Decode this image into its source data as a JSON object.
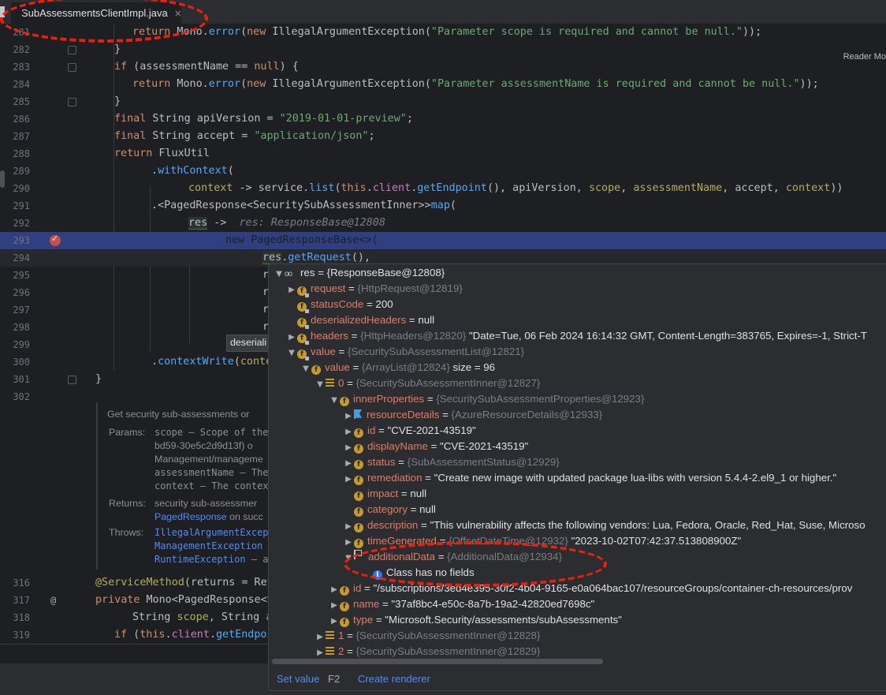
{
  "tab": {
    "label": "SubAssessmentsClientImpl.java",
    "close": "×"
  },
  "reader_mode": "Reader Mo",
  "lines": [
    {
      "num": "281",
      "code": "return Mono.error(new IllegalArgumentException(\"Parameter scope is required and cannot be null.\"));"
    },
    {
      "num": "282",
      "code": "}"
    },
    {
      "num": "283",
      "code": "if (assessmentName == null) {"
    },
    {
      "num": "284",
      "code": "return Mono.error(new IllegalArgumentException(\"Parameter assessmentName is required and cannot be null.\"));"
    },
    {
      "num": "285",
      "code": "}"
    },
    {
      "num": "286",
      "code": "final String apiVersion = \"2019-01-01-preview\";"
    },
    {
      "num": "287",
      "code": "final String accept = \"application/json\";"
    },
    {
      "num": "288",
      "code": "return FluxUtil"
    },
    {
      "num": "289",
      "code": ".withContext("
    },
    {
      "num": "290",
      "code": "context -> service.list(this.client.getEndpoint(), apiVersion, scope, assessmentName, accept, context))"
    },
    {
      "num": "291",
      "code": ".<PagedResponse<SecuritySubAssessmentInner>>map("
    },
    {
      "num": "292",
      "code": "res ->",
      "hint": "res: ResponseBase@12808"
    },
    {
      "num": "293",
      "code": "new PagedResponseBase<>("
    },
    {
      "num": "294",
      "code": "res.getRequest(),"
    },
    {
      "num": "295",
      "code": "r"
    },
    {
      "num": "296",
      "code": "r"
    },
    {
      "num": "297",
      "code": "r"
    },
    {
      "num": "298",
      "code": "r"
    },
    {
      "num": "299",
      "code": ""
    },
    {
      "num": "300",
      "code": ".contextWrite(conte"
    },
    {
      "num": "301",
      "code": "}"
    },
    {
      "num": "302",
      "code": ""
    },
    {
      "num": "316",
      "code": "@ServiceMethod(returns = Ret"
    },
    {
      "num": "317",
      "code": "private Mono<PagedResponse<S"
    },
    {
      "num": "318",
      "code": "String scope, String a"
    },
    {
      "num": "319",
      "code": "if (this.client.getEndpoi"
    }
  ],
  "tooltip": "deseriali",
  "doc": {
    "summary": "Get security sub-assessments or",
    "params_label": "Params:",
    "p1": "scope – Scope of the q",
    "p2": "bd59-30e5c2d9d13f) o",
    "p3": "Management/manageme",
    "p4": "assessmentName – The",
    "p5": "context – The context",
    "returns_label": "Returns:",
    "r1": "security sub-assessmer",
    "r2a": "PagedResponse",
    "r2b": " on succ",
    "throws_label": "Throws:",
    "t1": "IllegalArgumentExcept",
    "t2a": "ManagementException",
    "t2b": " –",
    "t3a": "RuntimeException",
    "t3b": " – all"
  },
  "debug": {
    "root": {
      "name": "res",
      "eq": " = ",
      "ref": "{ResponseBase@12808}"
    },
    "rows": [
      {
        "name": "request",
        "ref": "{HttpRequest@12819}",
        "val": ""
      },
      {
        "name": "statusCode",
        "ref": "",
        "val": "200"
      },
      {
        "name": "deserializedHeaders",
        "ref": "",
        "val": "null"
      },
      {
        "name": "headers",
        "ref": "{HttpHeaders@12820}",
        "val": "\"Date=Tue, 06 Feb 2024 16:14:32 GMT, Content-Length=383765, Expires=-1, Strict-T"
      },
      {
        "name": "value",
        "ref": "{SecuritySubAssessmentList@12821}",
        "val": ""
      },
      {
        "name": "value",
        "ref": "{ArrayList@12824}",
        "val": " size = 96"
      },
      {
        "name": "0",
        "ref": "{SecuritySubAssessmentInner@12827}",
        "val": ""
      },
      {
        "name": "innerProperties",
        "ref": "{SecuritySubAssessmentProperties@12923}",
        "val": ""
      },
      {
        "name": "resourceDetails",
        "ref": "{AzureResourceDetails@12933}",
        "val": ""
      },
      {
        "name": "id",
        "ref": "",
        "val": "\"CVE-2021-43519\""
      },
      {
        "name": "displayName",
        "ref": "",
        "val": "\"CVE-2021-43519\""
      },
      {
        "name": "status",
        "ref": "{SubAssessmentStatus@12929}",
        "val": ""
      },
      {
        "name": "remediation",
        "ref": "",
        "val": "\"Create new image with updated package lua-libs with version 5.4.4-2.el9_1 or higher.\""
      },
      {
        "name": "impact",
        "ref": "",
        "val": "null"
      },
      {
        "name": "category",
        "ref": "",
        "val": "null"
      },
      {
        "name": "description",
        "ref": "",
        "val": "\"This vulnerability affects the following vendors: Lua, Fedora, Oracle, Red_Hat, Suse, Microso"
      },
      {
        "name": "timeGenerated",
        "ref": "{OffsetDateTime@12932}",
        "val": "\"2023-10-02T07:42:37.513808900Z\""
      },
      {
        "name": "additionalData",
        "ref": "{AdditionalData@12934}",
        "val": ""
      },
      {
        "name": "",
        "ref": "",
        "val": "Class has no fields"
      },
      {
        "name": "id",
        "ref": "",
        "val": "\"/subscriptions/3ed4e395-30f2-4b04-9165-e0a064bac107/resourceGroups/container-ch-resources/prov"
      },
      {
        "name": "name",
        "ref": "",
        "val": "\"37af8bc4-e50c-8a7b-19a2-42820ed7698c\""
      },
      {
        "name": "type",
        "ref": "",
        "val": "\"Microsoft.Security/assessments/subAssessments\""
      },
      {
        "name": "1",
        "ref": "{SecuritySubAssessmentInner@12828}",
        "val": ""
      },
      {
        "name": "2",
        "ref": "{SecuritySubAssessmentInner@12829}",
        "val": ""
      }
    ],
    "set_value": "Set value",
    "set_value_key": "F2",
    "create_renderer": "Create renderer"
  },
  "annotation_color": "#e8200f"
}
